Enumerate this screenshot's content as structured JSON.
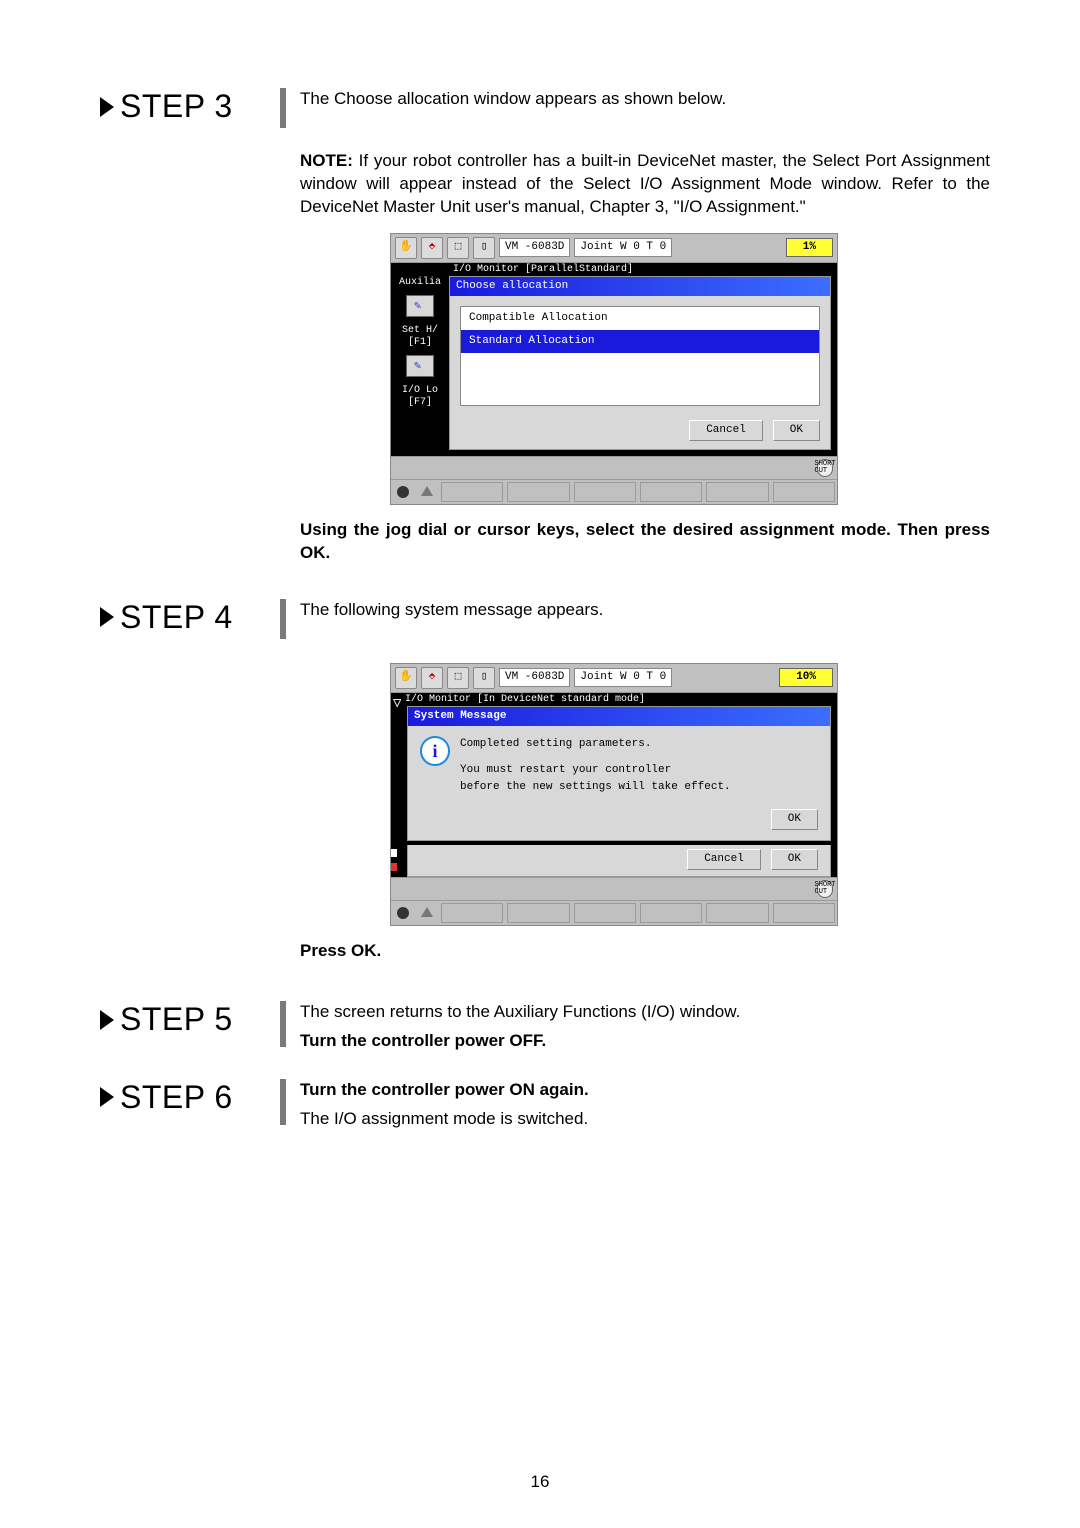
{
  "steps": {
    "s3": {
      "label": "STEP 3",
      "intro": "The Choose allocation window appears as shown below.",
      "note_lead": "NOTE:",
      "note_body": " If your robot controller has a built-in DeviceNet master, the Select Port Assignment window will appear instead of the Select I/O Assignment Mode window.  Refer to the DeviceNet Master Unit user's manual, Chapter 3, \"I/O Assignment.\"",
      "instruction": "Using the jog dial or cursor keys, select the desired assignment mode. Then press OK."
    },
    "s4": {
      "label": "STEP 4",
      "intro": "The following system message appears.",
      "press_ok": "Press OK."
    },
    "s5": {
      "label": "STEP 5",
      "line1": "The screen returns to the Auxiliary Functions (I/O) window.",
      "line2": "Turn the controller power OFF."
    },
    "s6": {
      "label": "STEP 6",
      "line1": "Turn the controller power ON again.",
      "line2": "The I/O assignment mode is switched."
    }
  },
  "pendant1": {
    "vm": "VM -6083D",
    "joint": "Joint  W 0 T 0",
    "batt": "1%",
    "io_title": "I/O Monitor [ParallelStandard]",
    "side_aux": "Auxilia",
    "side_set": "Set H/\n[F1]",
    "side_io": "I/O Lo\n[F7]",
    "win_title": "Choose allocation",
    "opt1": "Compatible Allocation",
    "opt2": "Standard Allocation",
    "cancel": "Cancel",
    "ok": "OK",
    "short": "SHORT\nCUT"
  },
  "pendant2": {
    "vm": "VM -6083D",
    "joint": "Joint  W 0 T 0",
    "batt": "10%",
    "io_title": "I/O Monitor [In DeviceNet standard mode]",
    "win_title": "System Message",
    "msg_l1": "Completed setting parameters.",
    "msg_l2": "You must restart your controller",
    "msg_l3": "before the new settings will take effect.",
    "ok": "OK",
    "cancel": "Cancel",
    "short": "SHORT\nCUT"
  },
  "page_number": "16"
}
